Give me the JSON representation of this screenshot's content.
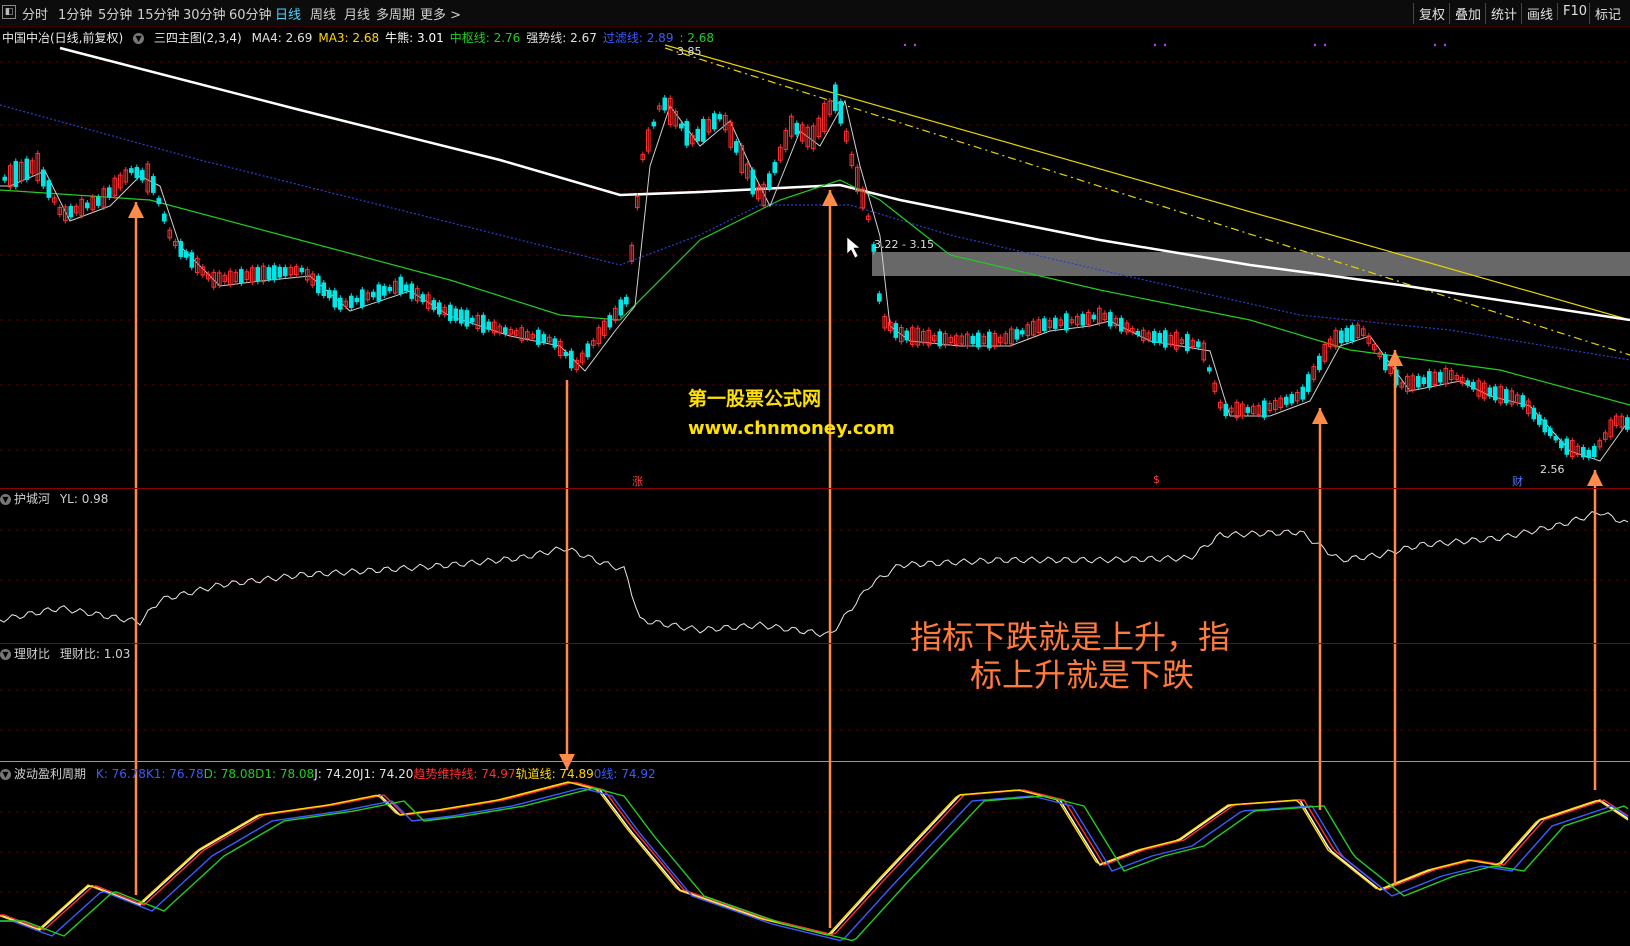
{
  "toolbar": {
    "periods": [
      "分时",
      "1分钟",
      "5分钟",
      "15分钟",
      "30分钟",
      "60分钟",
      "日线",
      "周线",
      "月线",
      "多周期",
      "更多 >"
    ],
    "active_period": "日线",
    "right_buttons": [
      "复权",
      "叠加",
      "统计",
      "画线",
      "F10",
      "标记"
    ]
  },
  "main_legend": {
    "stock": "中国中冶(日线,前复权)",
    "indicator": "三四主图(2,3,4)",
    "items": [
      {
        "label": "MA4: 2.69",
        "color": "#e0e0e0"
      },
      {
        "label": "MA3: 2.68",
        "color": "#ffd700"
      },
      {
        "label": "牛熊: 3.01",
        "color": "#ffffff"
      },
      {
        "label": "中枢线: 2.76",
        "color": "#22cc22"
      },
      {
        "label": "强势线: 2.67",
        "color": "#e0e0e0"
      },
      {
        "label": "过滤线: 2.89",
        "color": "#3a5bff"
      },
      {
        "label": ": 2.68",
        "color": "#22cc22"
      }
    ]
  },
  "price_labels": {
    "high": "3.85",
    "range": "3.22 - 3.15",
    "low": "2.56"
  },
  "event_markers": [
    "涨",
    "$",
    "财"
  ],
  "panels": {
    "p1": {
      "name": "护城河",
      "value": "YL: 0.98"
    },
    "p2": {
      "name": "理财比",
      "value": "理财比: 1.03"
    },
    "p3": {
      "name": "波动盈利周期",
      "items": [
        {
          "label": "K: 76.78",
          "color": "#3a5bff"
        },
        {
          "label": "K1: 76.78",
          "color": "#3a5bff"
        },
        {
          "label": "D: 78.08",
          "color": "#22cc22"
        },
        {
          "label": "D1: 78.08",
          "color": "#22cc22"
        },
        {
          "label": "J: 74.20",
          "color": "#e0e0e0"
        },
        {
          "label": "J1: 74.20",
          "color": "#e0e0e0"
        },
        {
          "label": "趋势维持线: 74.97",
          "color": "#ff3030"
        },
        {
          "label": "轨道线: 74.89",
          "color": "#ffd700"
        },
        {
          "label": "0线: 74.92",
          "color": "#3a5bff"
        }
      ]
    }
  },
  "watermark": {
    "line1": "第一股票公式网",
    "line2": "www.chnmoney.com"
  },
  "annotation": {
    "line1": "指标下跌就是上升，指",
    "line2": "标上升就是下跌"
  },
  "colors": {
    "up": "#ff3030",
    "down": "#00e5e5",
    "arrow": "#ff8a4a",
    "separator": "#8b0000"
  }
}
